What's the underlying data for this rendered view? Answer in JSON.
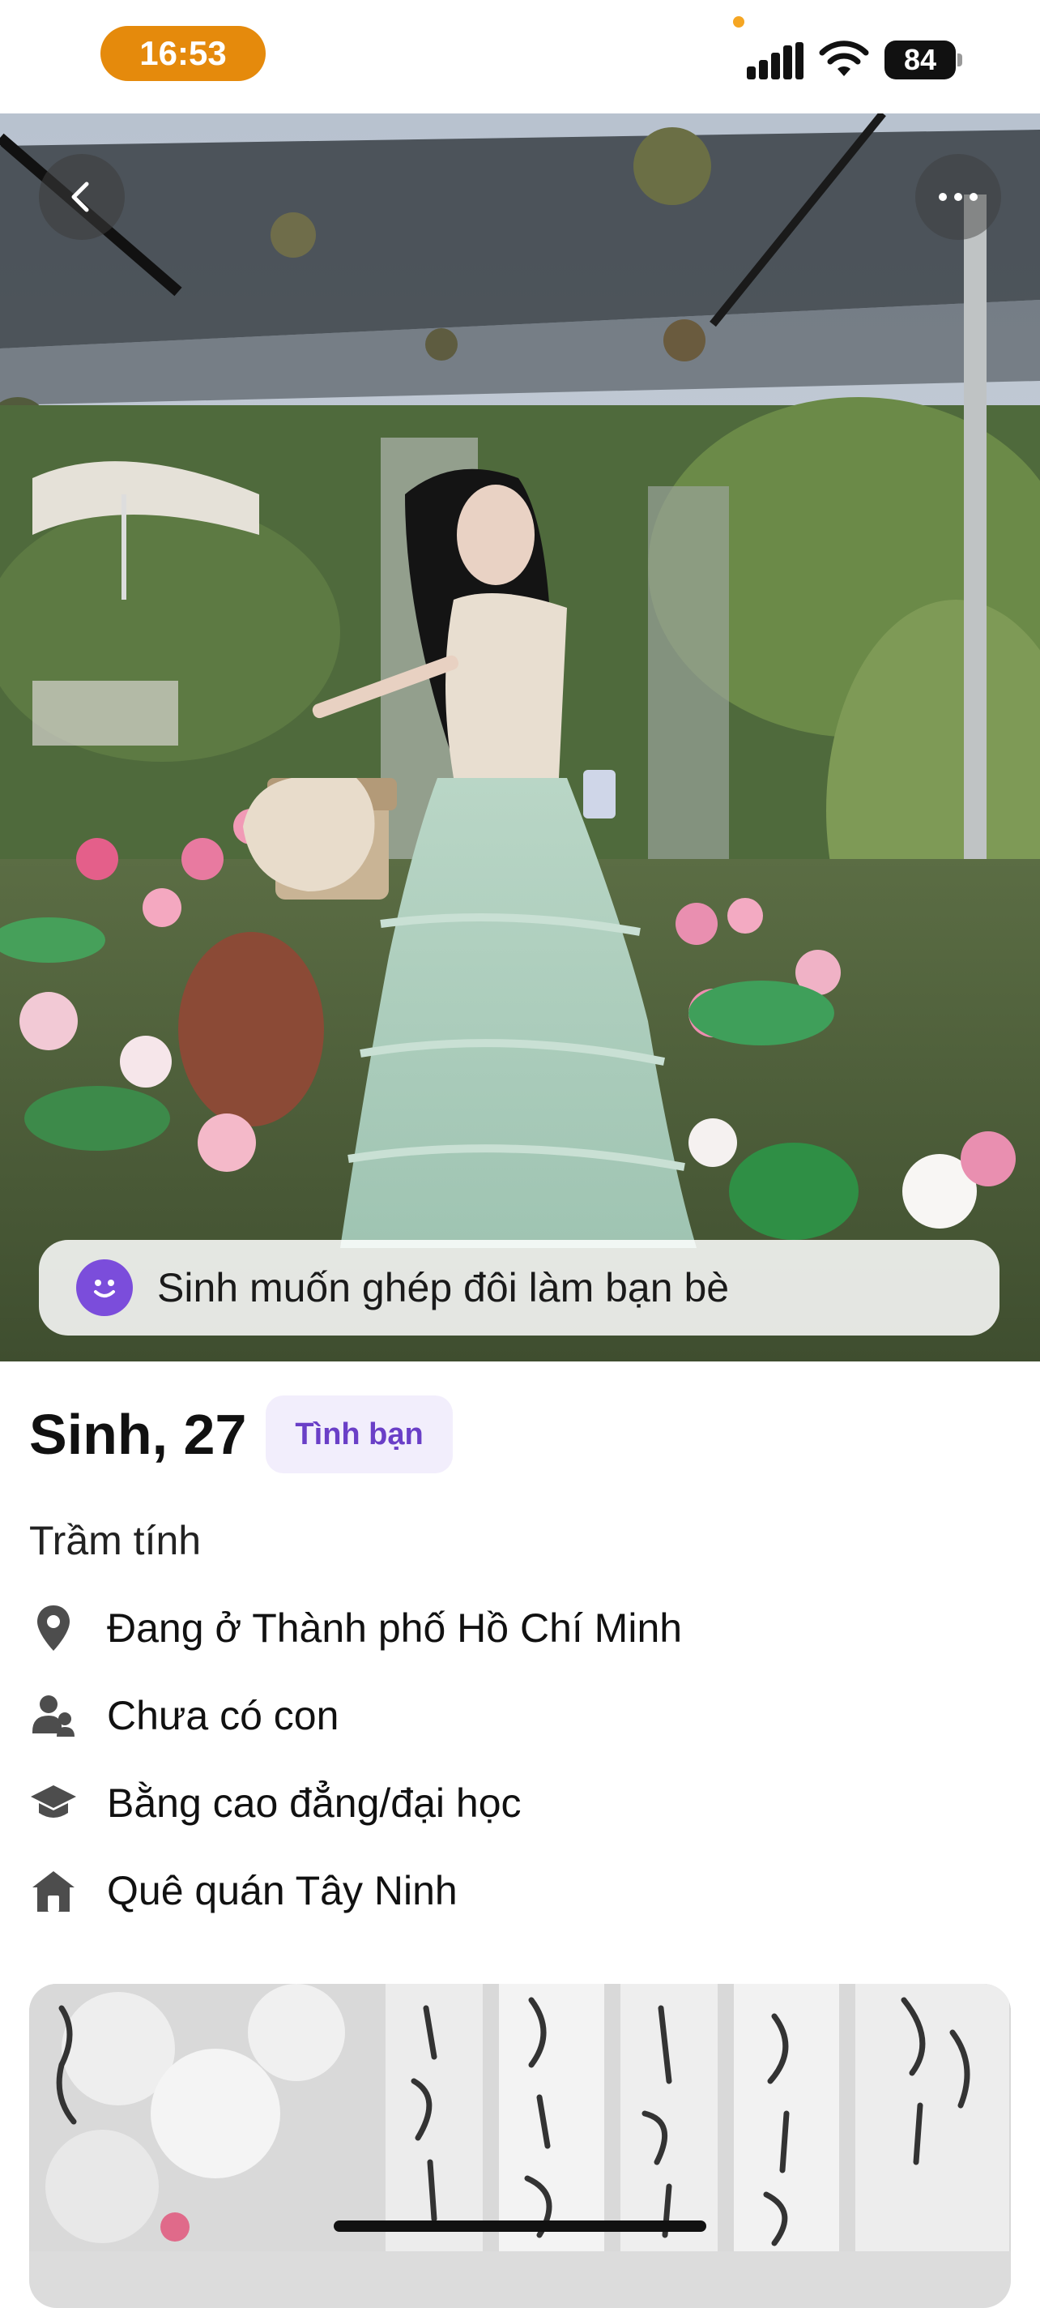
{
  "status_bar": {
    "time": "16:53",
    "battery": "84",
    "icons": [
      "signal-icon",
      "wifi-icon",
      "battery-icon"
    ]
  },
  "hero": {
    "back_icon": "chevron-left-icon",
    "more_icon": "more-horizontal-icon",
    "banner_icon": "smile-icon",
    "banner_text": "Sinh muốn ghép đôi làm bạn bè"
  },
  "profile": {
    "name_age": "Sinh, 27",
    "tag": "Tình bạn",
    "bio": "Trầm tính",
    "details": [
      {
        "icon": "location-pin-icon",
        "text": "Đang ở Thành phố Hồ Chí Minh"
      },
      {
        "icon": "people-icon",
        "text": "Chưa có con"
      },
      {
        "icon": "graduation-cap-icon",
        "text": "Bằng cao đẳng/đại học"
      },
      {
        "icon": "home-icon",
        "text": "Quê quán Tây Ninh"
      }
    ]
  },
  "colors": {
    "status_pill": "#e58a0c",
    "accent_purple": "#7b4ddb",
    "tag_bg": "#f2eefc",
    "tag_text": "#6a3fc7"
  }
}
